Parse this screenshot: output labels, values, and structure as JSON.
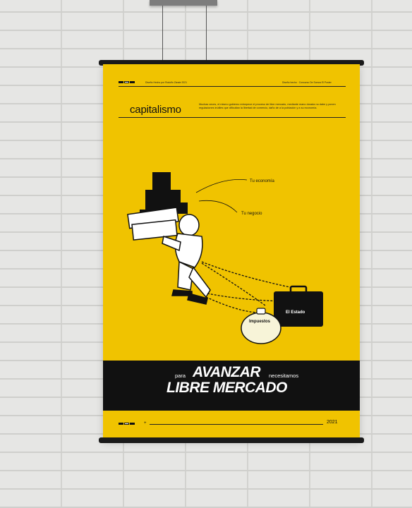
{
  "poster": {
    "title": "capitalismo",
    "header_left": "Diseño Hecho por Rodolfo Zárate  2021",
    "header_right": "Diseño hecho  ·  Concurso De Somos El Poster",
    "description": "Muchas veces, el mismo gobierno entorpece el proceso de libre mercado, mediante mano dorada no dabe y ponen regulaciones inútiles que dificultan la libertad de comercio, daño de a la población y a su economía.",
    "labels": {
      "tu_economia": "Tu economía",
      "tu_negocio": "Tu negocio",
      "el_estado": "El Estado",
      "impuestos": "Impuestos"
    },
    "slogan": {
      "para": "para",
      "avanzar": "AVANZAR",
      "necesitamos": "necesitamos",
      "libre_mercado": "LIBRE MERCADO"
    },
    "year": "2021"
  },
  "colors": {
    "poster_yellow": "#f0c300",
    "band_black": "#111111",
    "wall": "#e6e6e4"
  }
}
